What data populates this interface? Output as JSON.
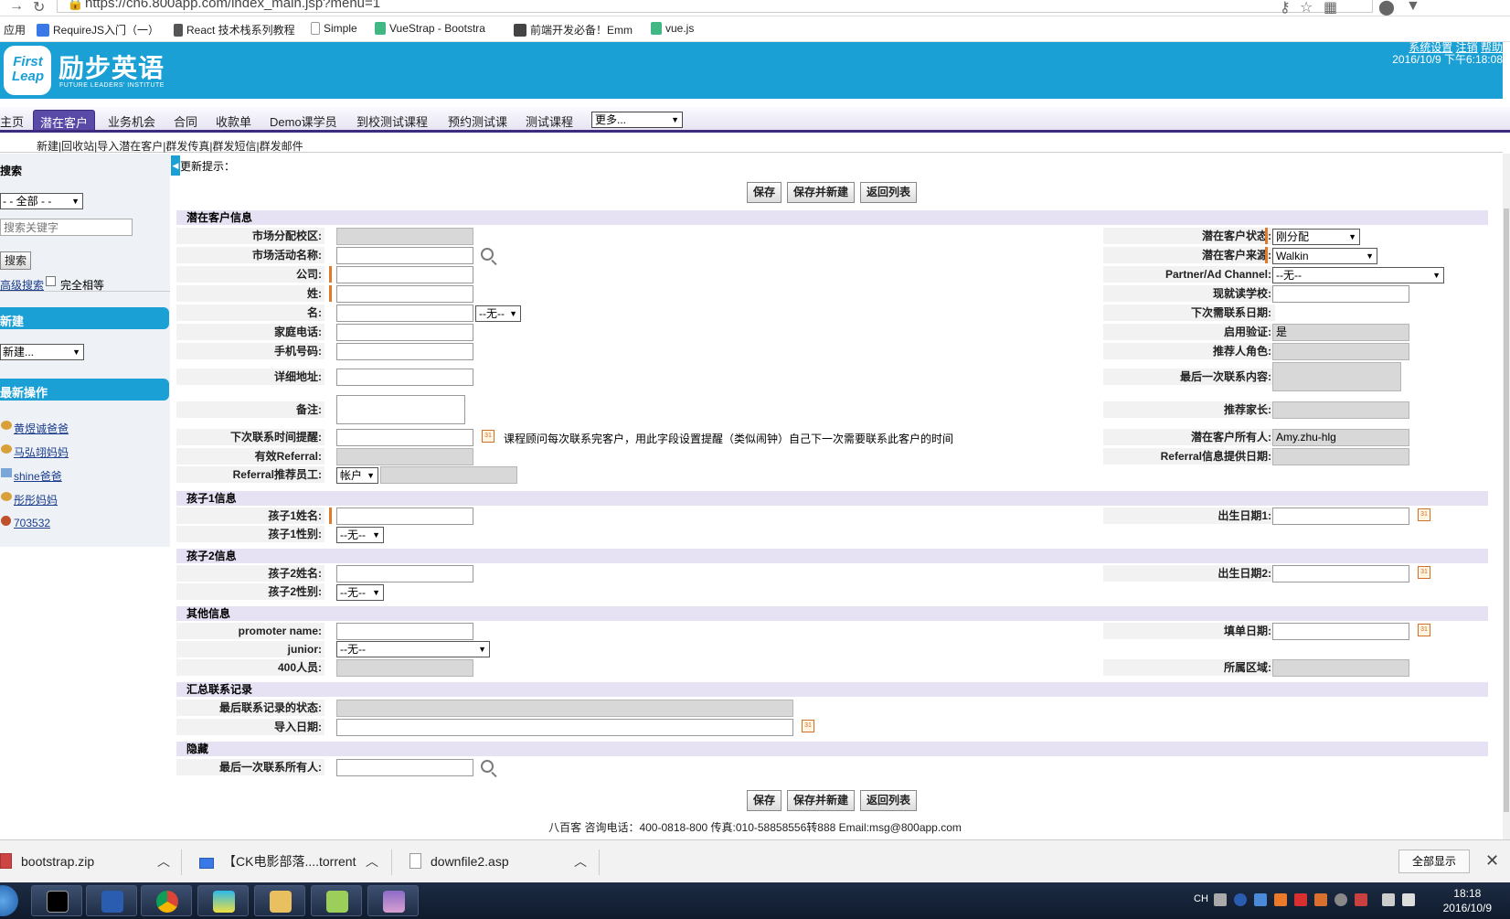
{
  "browser": {
    "url": "https://cn6.800app.com/index_main.jsp?menu=1"
  },
  "bookmarks": [
    {
      "label": "应用",
      "color": "#3b78e7"
    },
    {
      "label": "RequireJS入门（一）",
      "color": "#3b78e7"
    },
    {
      "label": "React 技术栈系列教程",
      "color": "#555"
    },
    {
      "label": "Simple",
      "color": "#999"
    },
    {
      "label": "VueStrap - Bootstra",
      "color": "#41b883"
    },
    {
      "label": "前端开发必备！Emm",
      "color": "#444"
    },
    {
      "label": "vue.js",
      "color": "#41b883"
    }
  ],
  "header": {
    "logo_badge": "First Leap",
    "logo_text": "励步英语",
    "logo_sub": "FUTURE LEADERS' INSTITUTE",
    "links": [
      "系统设置",
      "注销",
      "帮助"
    ],
    "datetime": "2016/10/9 下午6:18:08"
  },
  "nav": {
    "tabs": [
      "主页",
      "潜在客户",
      "业务机会",
      "合同",
      "收款单",
      "Demo课学员",
      "到校测试课程",
      "预约测试课",
      "测试课程"
    ],
    "active_tab": "潜在客户",
    "more": "更多..."
  },
  "subnav": "新建|回收站|导入潜在客户|群发传真|群发短信|群发邮件",
  "sidebar": {
    "search_title": "搜索",
    "scope_select": "- - 全部 - -",
    "search_placeholder": "搜索关键字",
    "search_button": "搜索",
    "advanced_search": "高级搜索",
    "exact_match": "完全相等",
    "new_title": "新建",
    "new_select": "新建...",
    "recent_title": "最新操作",
    "recent": [
      {
        "label": "黄煜诚爸爸",
        "icon": "people-icon"
      },
      {
        "label": "马弘翊妈妈",
        "icon": "people-icon"
      },
      {
        "label": "shine爸爸",
        "icon": "person-card-icon"
      },
      {
        "label": "彤彤妈妈",
        "icon": "people-icon"
      },
      {
        "label": "703532",
        "icon": "ball-icon"
      }
    ]
  },
  "form": {
    "hint": "更新提示：",
    "buttons": {
      "save": "保存",
      "save_new": "保存并新建",
      "back": "返回列表"
    },
    "sections": {
      "lead": "潜在客户信息",
      "child1": "孩子1信息",
      "child2": "孩子2信息",
      "other": "其他信息",
      "summary": "汇总联系记录",
      "hidden": "隐藏"
    },
    "left": {
      "campus": "市场分配校区:",
      "campaign": "市场活动名称:",
      "company": "公司:",
      "last_name": "姓:",
      "first_name": "名:",
      "first_name_suffix": "--无--",
      "home_phone": "家庭电话:",
      "mobile": "手机号码:",
      "address": "详细地址:",
      "remark": "备注:",
      "next_contact": "下次联系时间提醒:",
      "next_contact_hint": "课程顾问每次联系完客户，用此字段设置提醒（类似闹钟）自己下一次需要联系此客户的时间",
      "valid_referral": "有效Referral:",
      "referral_staff": "Referral推荐员工:",
      "referral_staff_type": "帐户"
    },
    "right": {
      "status": "潜在客户状态:",
      "status_value": "刚分配",
      "source": "潜在客户来源:",
      "source_value": "Walkin",
      "channel": "Partner/Ad Channel:",
      "channel_value": "--无--",
      "school": "现就读学校:",
      "next_date": "下次需联系日期:",
      "verify": "启用验证:",
      "verify_value": "是",
      "referrer_role": "推荐人角色:",
      "last_content": "最后一次联系内容:",
      "referrer_parent": "推荐家长:",
      "owner": "潜在客户所有人:",
      "owner_value": "Amy.zhu-hlg",
      "referral_provider": "Referral信息提供日期:"
    },
    "child1": {
      "name": "孩子1姓名:",
      "gender": "孩子1性别:",
      "gender_value": "--无--",
      "birth": "出生日期1:"
    },
    "child2": {
      "name": "孩子2姓名:",
      "gender": "孩子2性别:",
      "gender_value": "--无--",
      "birth": "出生日期2:"
    },
    "other": {
      "promoter": "promoter name:",
      "junior": "junior:",
      "junior_value": "--无--",
      "staff400": "400人员:",
      "fill_date": "填单日期:",
      "region": "所属区域:"
    },
    "summary": {
      "last_status": "最后联系记录的状态:",
      "import_date": "导入日期:"
    },
    "hidden": {
      "last_owner": "最后一次联系所有人:"
    }
  },
  "footer": "八百客 咨询电话：400-0818-800 传真:010-58858556转888 Email:msg@800app.com",
  "downloads": [
    {
      "name": "bootstrap.zip"
    },
    {
      "name": "【CK电影部落....torrent"
    },
    {
      "name": "downfile2.asp"
    }
  ],
  "downloads_show_all": "全部显示",
  "taskbar": {
    "lang": "CH",
    "time": "18:18",
    "date": "2016/10/9"
  }
}
